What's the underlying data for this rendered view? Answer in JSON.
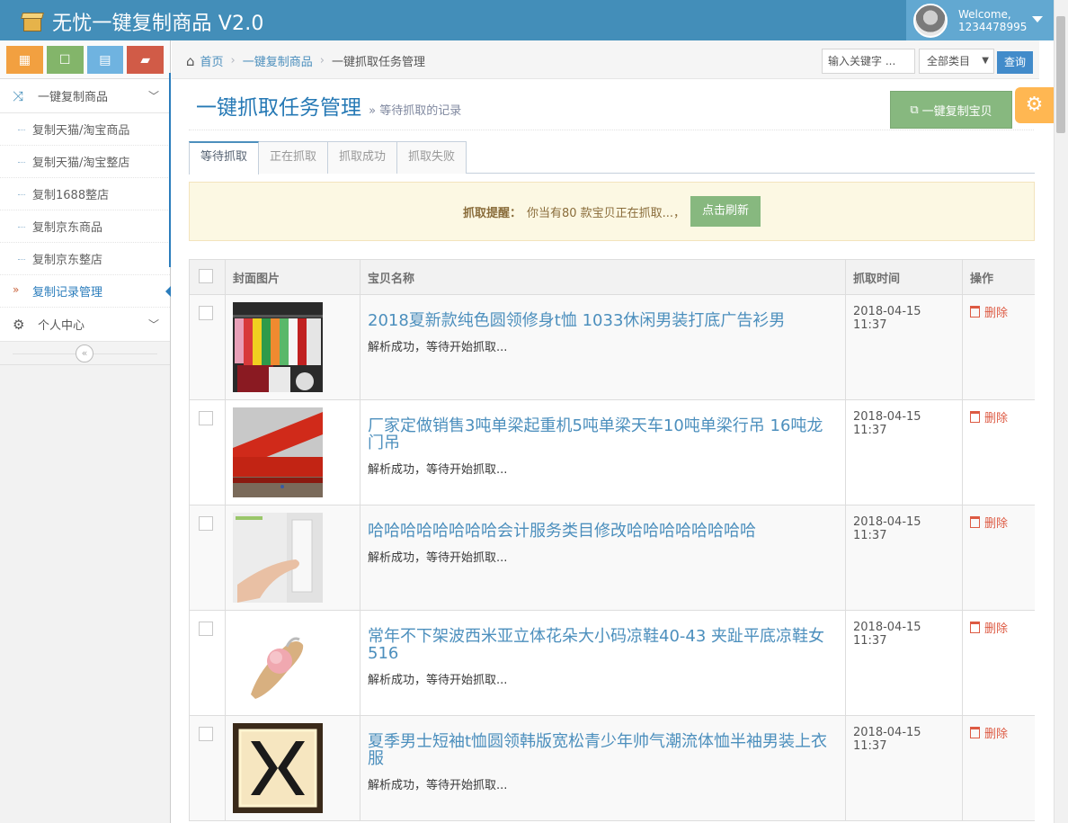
{
  "app": {
    "title": "无忧一键复制商品 V2.0"
  },
  "user": {
    "welcome": "Welcome,",
    "name": "1234478995"
  },
  "sidebar": {
    "parent1": "一键复制商品",
    "items": [
      {
        "label": "复制天猫/淘宝商品"
      },
      {
        "label": "复制天猫/淘宝整店"
      },
      {
        "label": "复制1688整店"
      },
      {
        "label": "复制京东商品"
      },
      {
        "label": "复制京东整店"
      },
      {
        "label": "复制记录管理"
      }
    ],
    "parent2": "个人中心"
  },
  "breadcrumb": {
    "home": "首页",
    "level1": "一键复制商品",
    "level2": "一键抓取任务管理"
  },
  "search": {
    "placeholder": "输入关键字 ...",
    "category": "全部类目",
    "button": "查询"
  },
  "page": {
    "title": "一键抓取任务管理",
    "subtitle": "» 等待抓取的记录",
    "copy_button": "一键复制宝贝"
  },
  "tabs": [
    "等待抓取",
    "正在抓取",
    "抓取成功",
    "抓取失败"
  ],
  "alert": {
    "label": "抓取提醒：",
    "text": "你当有80 款宝贝正在抓取...，",
    "button": "点击刷新"
  },
  "table": {
    "headers": [
      "封面图片",
      "宝贝名称",
      "抓取时间",
      "操作"
    ],
    "rows": [
      {
        "title": "2018夏新款纯色圆领修身t恤 1033休闲男装打底广告衫男",
        "status": "解析成功，等待开始抓取...",
        "time": "2018-04-15 11:37",
        "action": "删除"
      },
      {
        "title": "厂家定做销售3吨单梁起重机5吨单梁天车10吨单梁行吊 16吨龙门吊",
        "status": "解析成功，等待开始抓取...",
        "time": "2018-04-15 11:37",
        "action": "删除"
      },
      {
        "title": "哈哈哈哈哈哈哈哈会计服务类目修改哈哈哈哈哈哈哈哈",
        "status": "解析成功，等待开始抓取...",
        "time": "2018-04-15 11:37",
        "action": "删除"
      },
      {
        "title": "常年不下架波西米亚立体花朵大小码凉鞋40-43 夹趾平底凉鞋女516",
        "status": "解析成功，等待开始抓取...",
        "time": "2018-04-15 11:37",
        "action": "删除"
      },
      {
        "title": "夏季男士短袖t恤圆领韩版宽松青少年帅气潮流体恤半袖男装上衣服",
        "status": "解析成功，等待开始抓取...",
        "time": "2018-04-15 11:37",
        "action": "删除"
      }
    ]
  }
}
